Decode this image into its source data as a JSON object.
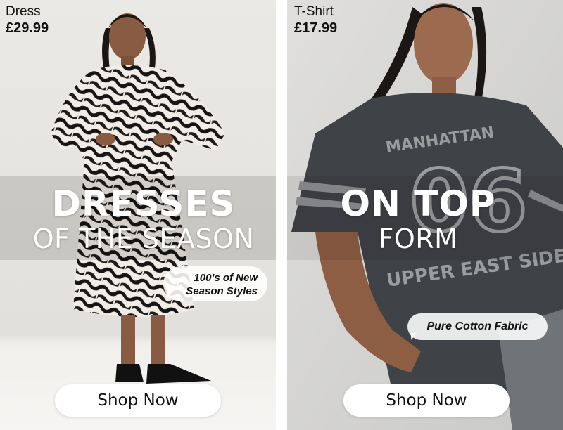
{
  "left_panel": {
    "product_name": "Dress",
    "product_price": "£29.99",
    "headline_bold": "DRESSES",
    "headline_light": "OF THE SEASON",
    "callout_line1": "100’s of New",
    "callout_line2": "Season Styles",
    "cta_label": "Shop Now"
  },
  "right_panel": {
    "product_name": "T-Shirt",
    "product_price": "£17.99",
    "headline_bold": "ON TOP",
    "headline_light": "FORM",
    "callout": "Pure Cotton Fabric",
    "cta_label": "Shop Now",
    "shirt_print_top": "MANHATTAN",
    "shirt_print_number": "06",
    "shirt_print_bottom": "UPPER EAST SIDE"
  },
  "colors": {
    "left_bg": "#e6e4e1",
    "right_bg": "#d9d9d7",
    "tee": "#3f4247",
    "button_bg": "#ffffff",
    "text_dark": "#111111"
  }
}
